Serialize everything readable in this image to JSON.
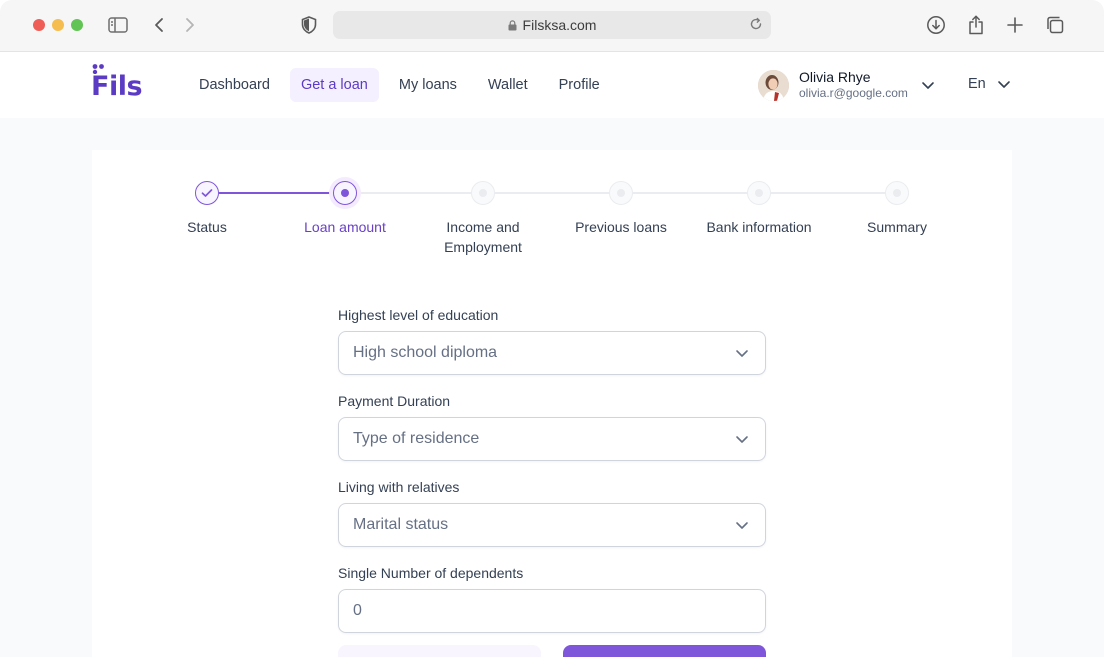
{
  "browser": {
    "url": "Filsksa.com",
    "icons": [
      "sidebar-icon",
      "back-arrow-icon",
      "forward-arrow-icon",
      "shield-icon",
      "lock-icon",
      "reload-icon",
      "download-icon",
      "share-icon",
      "new-tab-icon",
      "tabs-overview-icon"
    ]
  },
  "app": {
    "logo": "Fils",
    "nav": [
      {
        "label": "Dashboard"
      },
      {
        "label": "Get a loan",
        "active": true
      },
      {
        "label": "My loans"
      },
      {
        "label": "Wallet"
      },
      {
        "label": "Profile"
      }
    ],
    "user": {
      "name": "Olivia Rhye",
      "email": "olivia.r@google.com"
    },
    "language": "En"
  },
  "stepper": {
    "steps": [
      {
        "label": "Status",
        "state": "complete"
      },
      {
        "label": "Loan amount",
        "state": "current"
      },
      {
        "label": "Income and Employment",
        "state": "upcoming"
      },
      {
        "label": "Previous loans",
        "state": "upcoming"
      },
      {
        "label": "Bank information",
        "state": "upcoming"
      },
      {
        "label": "Summary",
        "state": "upcoming"
      }
    ]
  },
  "form": {
    "fields": [
      {
        "label": "Highest level of education",
        "type": "select",
        "value": "High school diploma"
      },
      {
        "label": "Payment Duration",
        "type": "select",
        "value": "Type of residence"
      },
      {
        "label": "Living with relatives",
        "type": "select",
        "value": "Marital status"
      },
      {
        "label": "Single Number of dependents",
        "type": "input",
        "value": "0"
      }
    ]
  },
  "colors": {
    "brand": "#5b3bc4",
    "primary": "#7f56d9",
    "primary_light": "#f9f5ff",
    "border": "#d0d5dd"
  }
}
